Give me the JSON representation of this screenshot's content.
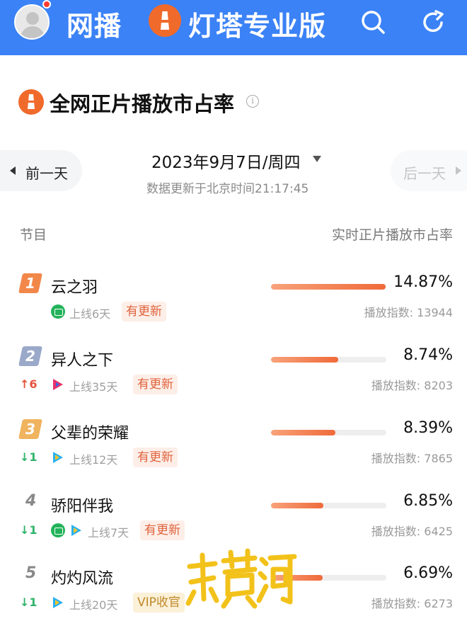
{
  "header": {
    "tab_wangbo": "网播",
    "tab_dengta": "灯塔专业版"
  },
  "section": {
    "title": "全网正片播放市占率"
  },
  "date_nav": {
    "prev_label": "前一天",
    "next_label": "后一天",
    "date": "2023年9月7日/周四",
    "updated": "数据更新于北京时间21:17:45"
  },
  "columns": {
    "left": "节目",
    "right": "实时正片播放市占率"
  },
  "rows": [
    {
      "rank": "1",
      "rank_color": "#f2874a",
      "title": "云之羽",
      "rank_change": "",
      "rank_dir": "",
      "platforms": [
        "iqiyi"
      ],
      "online": "上线6天",
      "tag": "有更新",
      "tag_type": "update",
      "share": 14.87,
      "share_text": "14.87%",
      "index_text": "播放指数: 13944"
    },
    {
      "rank": "2",
      "rank_color": "#9aa9c9",
      "title": "异人之下",
      "rank_change": "↑6",
      "rank_dir": "up",
      "platforms": [
        "youku"
      ],
      "online": "上线35天",
      "tag": "有更新",
      "tag_type": "update",
      "share": 8.74,
      "share_text": "8.74%",
      "index_text": "播放指数: 8203"
    },
    {
      "rank": "3",
      "rank_color": "#f0b35e",
      "title": "父辈的荣耀",
      "rank_change": "↓1",
      "rank_dir": "down",
      "platforms": [
        "tencent"
      ],
      "online": "上线12天",
      "tag": "有更新",
      "tag_type": "update",
      "share": 8.39,
      "share_text": "8.39%",
      "index_text": "播放指数: 7865"
    },
    {
      "rank": "4",
      "rank_color": "",
      "title": "骄阳伴我",
      "rank_change": "↓1",
      "rank_dir": "down",
      "platforms": [
        "iqiyi",
        "tencent"
      ],
      "online": "上线7天",
      "tag": "有更新",
      "tag_type": "update",
      "share": 6.85,
      "share_text": "6.85%",
      "index_text": "播放指数: 6425"
    },
    {
      "rank": "5",
      "rank_color": "",
      "title": "灼灼风流",
      "rank_change": "↓1",
      "rank_dir": "down",
      "platforms": [
        "tencent"
      ],
      "online": "上线20天",
      "tag": "VIP收官",
      "tag_type": "vip",
      "share": 6.69,
      "share_text": "6.69%",
      "index_text": "播放指数: 6273"
    }
  ],
  "bar_max": 15.0,
  "colors": {
    "header_bg": "#3b82f6",
    "accent": "#ef6a3a",
    "up": "#e5533c",
    "down": "#2fb36a"
  },
  "icons": [
    "avatar",
    "dengta-logo-icon",
    "search-icon",
    "share-icon",
    "info-icon",
    "iqiyi-icon",
    "tencent-video-icon",
    "youku-icon"
  ],
  "watermark": "新黄河"
}
